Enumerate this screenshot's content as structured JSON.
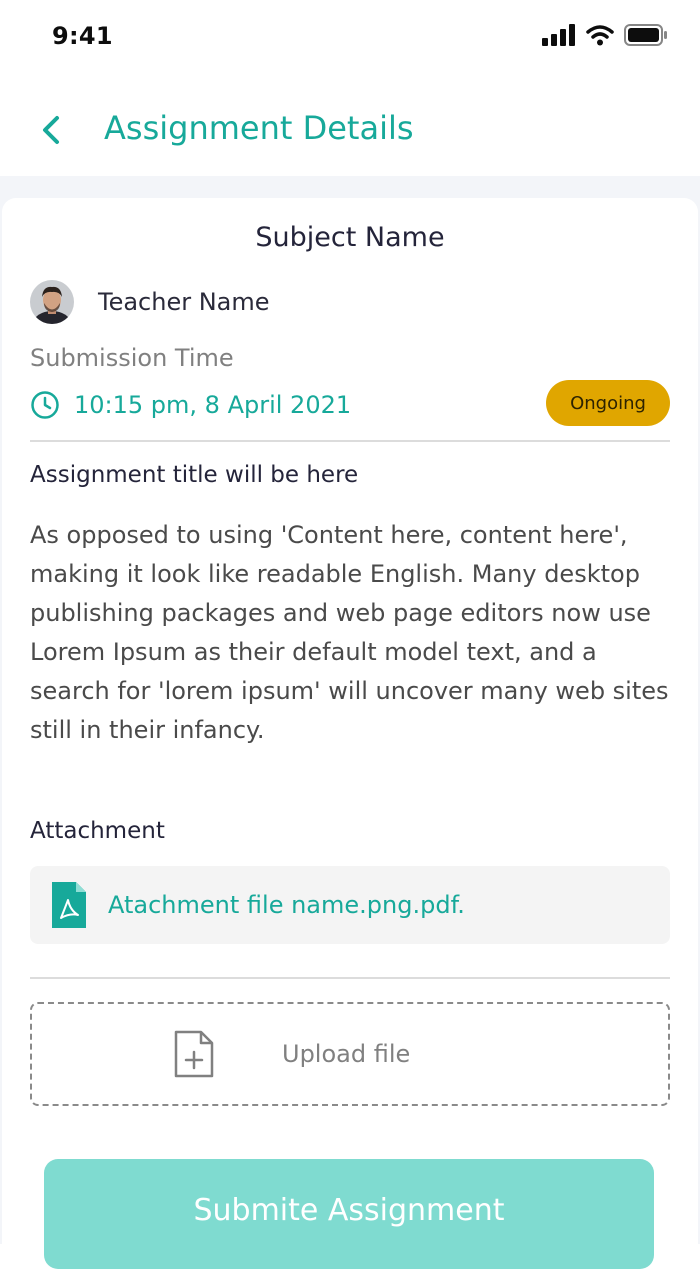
{
  "status_bar": {
    "time": "9:41"
  },
  "header": {
    "title": "Assignment Details"
  },
  "card": {
    "subject": "Subject Name",
    "teacher_name": "Teacher Name",
    "submission_label": "Submission Time",
    "submission_time": "10:15 pm, 8 April 2021",
    "status_badge": "Ongoing",
    "assignment_title": "Assignment title will be here",
    "description": "As opposed to using 'Content here, content here', making it look like readable English. Many desktop publishing packages and web page editors now use Lorem Ipsum as their default model text, and a search for 'lorem ipsum' will uncover many web sites still in their infancy.",
    "attachment_label": "Attachment",
    "attachment_file": "Atachment file name.png.pdf.",
    "upload_label": "Upload file"
  },
  "submit_button": {
    "label": "Submite Assignment"
  },
  "colors": {
    "accent": "#17a99a",
    "badge": "#e0a600",
    "submit_bg": "#7fdbd0"
  }
}
